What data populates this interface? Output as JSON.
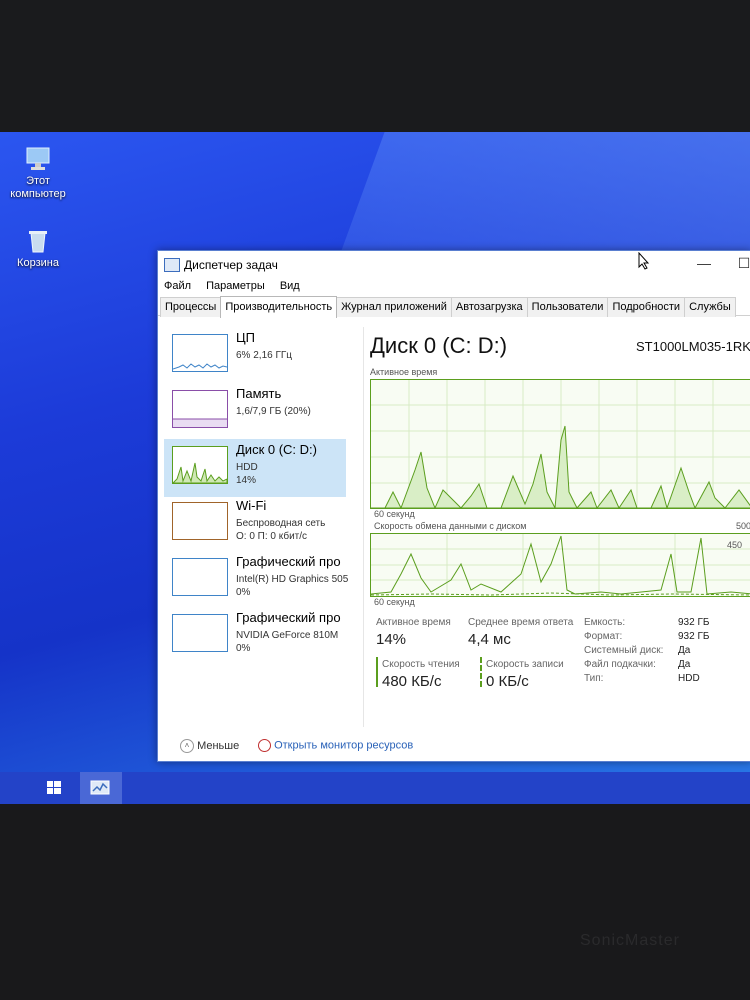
{
  "desktop": {
    "icons": [
      {
        "label": "Этот компьютер"
      },
      {
        "label": "Корзина"
      }
    ]
  },
  "window": {
    "title": "Диспетчер задач",
    "menu": [
      "Файл",
      "Параметры",
      "Вид"
    ],
    "tabs": [
      "Процессы",
      "Производительность",
      "Журнал приложений",
      "Автозагрузка",
      "Пользователи",
      "Подробности",
      "Службы"
    ],
    "active_tab": "Производительность"
  },
  "sidebar": {
    "items": [
      {
        "name": "ЦП",
        "sub1": "6% 2,16 ГГц",
        "sub2": ""
      },
      {
        "name": "Память",
        "sub1": "1,6/7,9 ГБ (20%)",
        "sub2": ""
      },
      {
        "name": "Диск 0 (C: D:)",
        "sub1": "HDD",
        "sub2": "14%"
      },
      {
        "name": "Wi-Fi",
        "sub1": "Беспроводная сеть",
        "sub2": "О: 0 П: 0 кбит/с"
      },
      {
        "name": "Графический про",
        "sub1": "Intel(R) HD Graphics 505",
        "sub2": "0%"
      },
      {
        "name": "Графический про",
        "sub1": "NVIDIA GeForce 810M",
        "sub2": "0%"
      }
    ]
  },
  "main": {
    "title": "Диск 0 (C: D:)",
    "model": "ST1000LM035-1RK",
    "graph1": {
      "label": "Активное время",
      "time_label": "60 секунд"
    },
    "graph2": {
      "label": "Скорость обмена данными с диском",
      "time_label": "60 секунд",
      "scale_top": "500",
      "scale_mid": "450"
    },
    "stats": {
      "active_time_label": "Активное время",
      "active_time_value": "14%",
      "response_label": "Среднее время ответа",
      "response_value": "4,4 мс",
      "read_label": "Скорость чтения",
      "read_value": "480 КБ/с",
      "write_label": "Скорость записи",
      "write_value": "0 КБ/с"
    },
    "props": [
      {
        "label": "Емкость:",
        "value": "932 ГБ"
      },
      {
        "label": "Формат:",
        "value": "932 ГБ"
      },
      {
        "label": "Системный диск:",
        "value": "Да"
      },
      {
        "label": "Файл подкачки:",
        "value": "Да"
      },
      {
        "label": "Тип:",
        "value": "HDD"
      }
    ]
  },
  "footer": {
    "less_label": "Меньше",
    "monitor_link": "Открыть монитор ресурсов"
  },
  "brand": "SonicMaster",
  "colors": {
    "desktop": "#1c3bd8",
    "accent": "#cce4f7",
    "disk_graph": "#5b9e1e"
  }
}
